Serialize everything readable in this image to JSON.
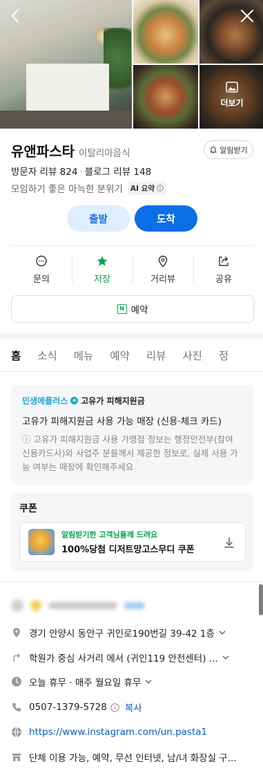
{
  "header": {
    "more_label": "더보기"
  },
  "place": {
    "name": "유앤파스타",
    "category": "이탈리아음식",
    "alarm_label": "알림받기",
    "visitor_reviews": "방문자 리뷰 824",
    "blog_reviews": "블로그 리뷰 148",
    "summary": "모임하기 좋은 아늑한 분위기",
    "ai_badge": "AI 요약"
  },
  "route": {
    "start_label": "출발",
    "arrive_label": "도착"
  },
  "actions": [
    {
      "label": "문의",
      "icon": "chat-icon"
    },
    {
      "label": "저장",
      "icon": "star-icon"
    },
    {
      "label": "거리뷰",
      "icon": "pin-icon"
    },
    {
      "label": "공유",
      "icon": "share-icon"
    }
  ],
  "reserve_label": "예약",
  "tabs": [
    "홈",
    "소식",
    "메뉴",
    "예약",
    "리뷰",
    "사진",
    "정"
  ],
  "benefit": {
    "brand": "민생에플러스",
    "brand_sub": "고유가 피해지원금",
    "main": "고유가 피해지원금 사용 가능 매장 (신용·체크 카드)",
    "note": "ⓘ 고유가 피해지원금 사용 가맹점 정보는 행정안전부(참여 신용카드사)와 사업주 분들께서 제공한 정보로, 실제 사용 가능 여부는 매장에 확인해주세요"
  },
  "coupon": {
    "title": "쿠폰",
    "sub": "알림받기한 고객님들께 드려요",
    "name": "100%당첨 디저트망고스무디 쿠폰"
  },
  "details": {
    "address": "경기 안양시 동안구 귀인로190번길 39-42 1층",
    "directions": "학원가 중심 사거리 에서 (귀인119 안전센터) ...",
    "hours": "오늘 휴무 · 매주 월요일 휴무",
    "phone": "0507-1379-5728",
    "copy_label": "복사",
    "website": "https://www.instagram.com/un.pasta1",
    "amenities": "단체 이용 가능, 예약, 무선 인터넷, 남/녀 화장실 구..."
  },
  "colors": {
    "naver_green": "#03a94d",
    "primary_blue": "#0b6fe8",
    "link_blue": "#0a58ca"
  }
}
